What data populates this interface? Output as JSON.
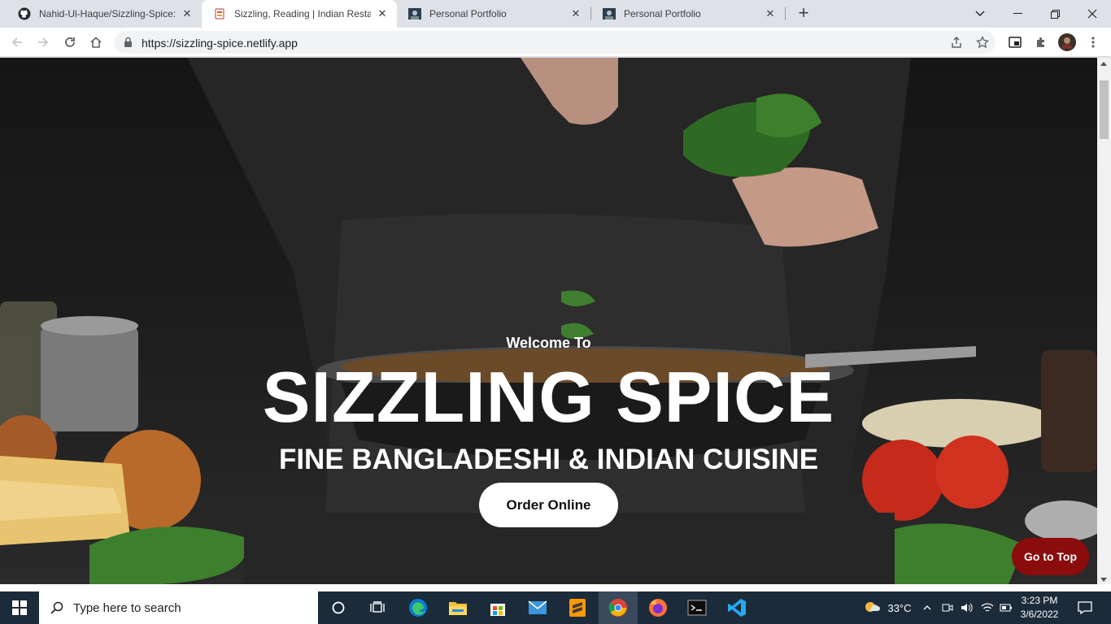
{
  "tabs": [
    {
      "title": "Nahid-Ul-Haque/Sizzling-Spice: T",
      "favicon": "github-icon",
      "active": false
    },
    {
      "title": "Sizzling, Reading | Indian Restaur",
      "favicon": "restaurant-icon",
      "active": true
    },
    {
      "title": "Personal Portfolio",
      "favicon": "portfolio-icon",
      "active": false
    },
    {
      "title": "Personal Portfolio",
      "favicon": "portfolio-icon",
      "active": false
    }
  ],
  "address_bar": {
    "url": "https://sizzling-spice.netlify.app"
  },
  "hero": {
    "welcome": "Welcome To",
    "brand": "SIZZLING SPICE",
    "tagline": "FINE BANGLADESHI & INDIAN CUISINE",
    "order_label": "Order Online"
  },
  "go_to_top_label": "Go to Top",
  "taskbar": {
    "search_placeholder": "Type here to search",
    "weather": "33°C",
    "time": "3:23 PM",
    "date": "3/6/2022"
  },
  "colors": {
    "go_to_top_bg": "#8b0c0c",
    "taskbar_bg": "#1c2b3a",
    "tab_strip_bg": "#dee1e6"
  }
}
